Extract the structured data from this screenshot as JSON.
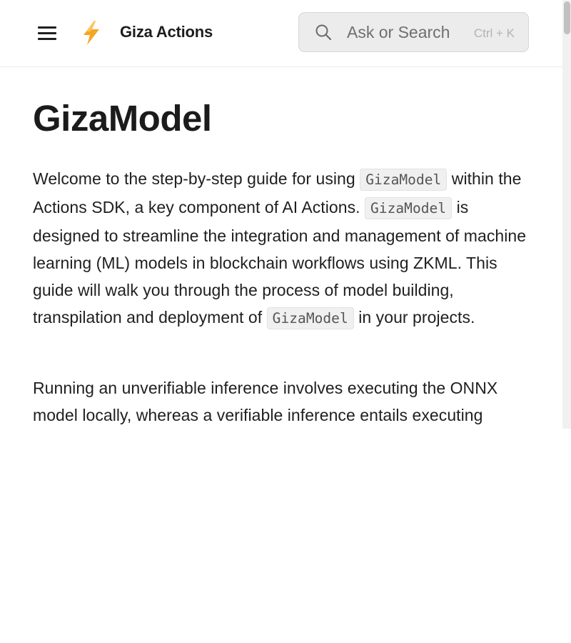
{
  "header": {
    "app_title": "Giza Actions",
    "logo_icon": "lightning-bolt-icon",
    "menu_icon": "hamburger-menu-icon",
    "search": {
      "placeholder": "Ask or Search",
      "shortcut": "Ctrl + K",
      "icon": "search-icon"
    }
  },
  "colors": {
    "logo_bolt": "#f5a623",
    "search_bg": "#ececec",
    "text": "#1f1f1f",
    "code_bg": "#f0f0f0"
  },
  "page": {
    "title": "GizaModel",
    "paragraphs": [
      {
        "segments": [
          "Welcome to the step-by-step guide for using",
          "GizaModel",
          "within the Actions SDK, a key component of AI Actions.",
          "GizaModel",
          "is designed to streamline the integration and management of machine learning (ML) models in blockchain workflows using ZKML. This guide will walk you through the process of model building, transpilation and deployment of",
          "GizaModel",
          "in your projects."
        ]
      },
      {
        "text": "Running an unverifiable inference involves executing the ONNX model locally, whereas a verifiable inference entails executing"
      }
    ]
  }
}
